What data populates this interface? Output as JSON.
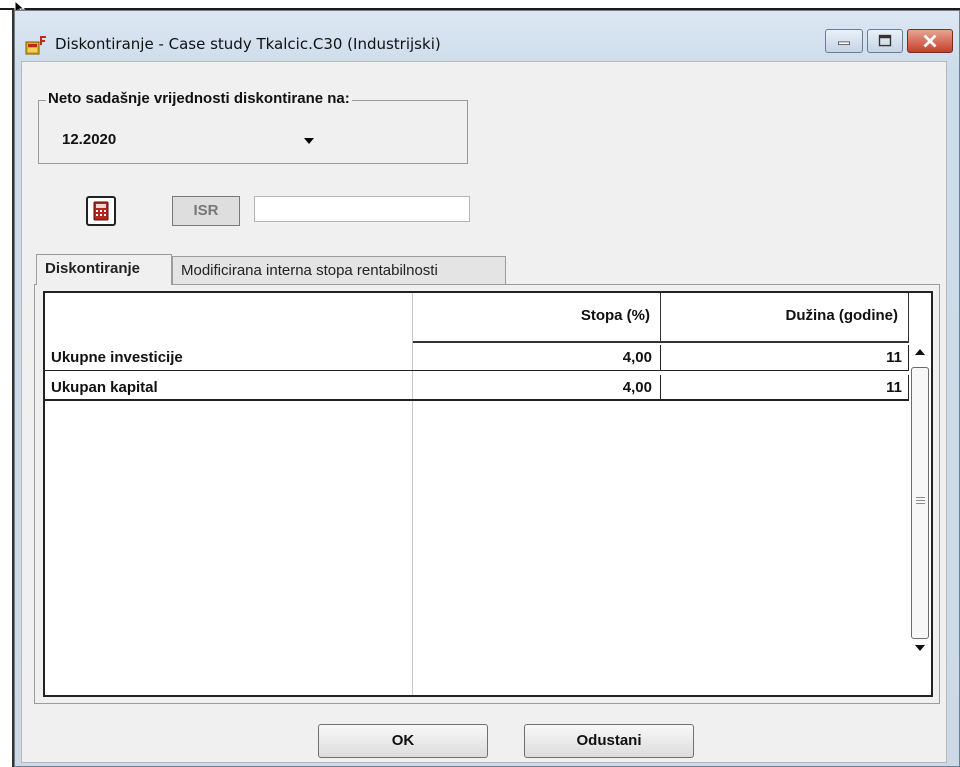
{
  "window": {
    "title": "Diskontiranje - Case study Tkalcic.C30 (Industrijski)"
  },
  "discount_group": {
    "label": "Neto sadašnje vrijednosti diskontirane na:",
    "selected_period": "12.2020"
  },
  "toolbar": {
    "isr_label": "ISR",
    "isr_value": ""
  },
  "tabs": [
    {
      "label": "Diskontiranje",
      "active": true
    },
    {
      "label": "Modificirana interna stopa rentabilnosti",
      "active": false
    }
  ],
  "grid": {
    "columns": [
      "",
      "Stopa (%)",
      "Dužina (godine)"
    ],
    "rows": [
      {
        "name": "Ukupne investicije",
        "stopa": "4,00",
        "duzina": "11"
      },
      {
        "name": "Ukupan kapital",
        "stopa": "4,00",
        "duzina": "11"
      }
    ]
  },
  "buttons": {
    "ok": "OK",
    "cancel": "Odustani"
  }
}
